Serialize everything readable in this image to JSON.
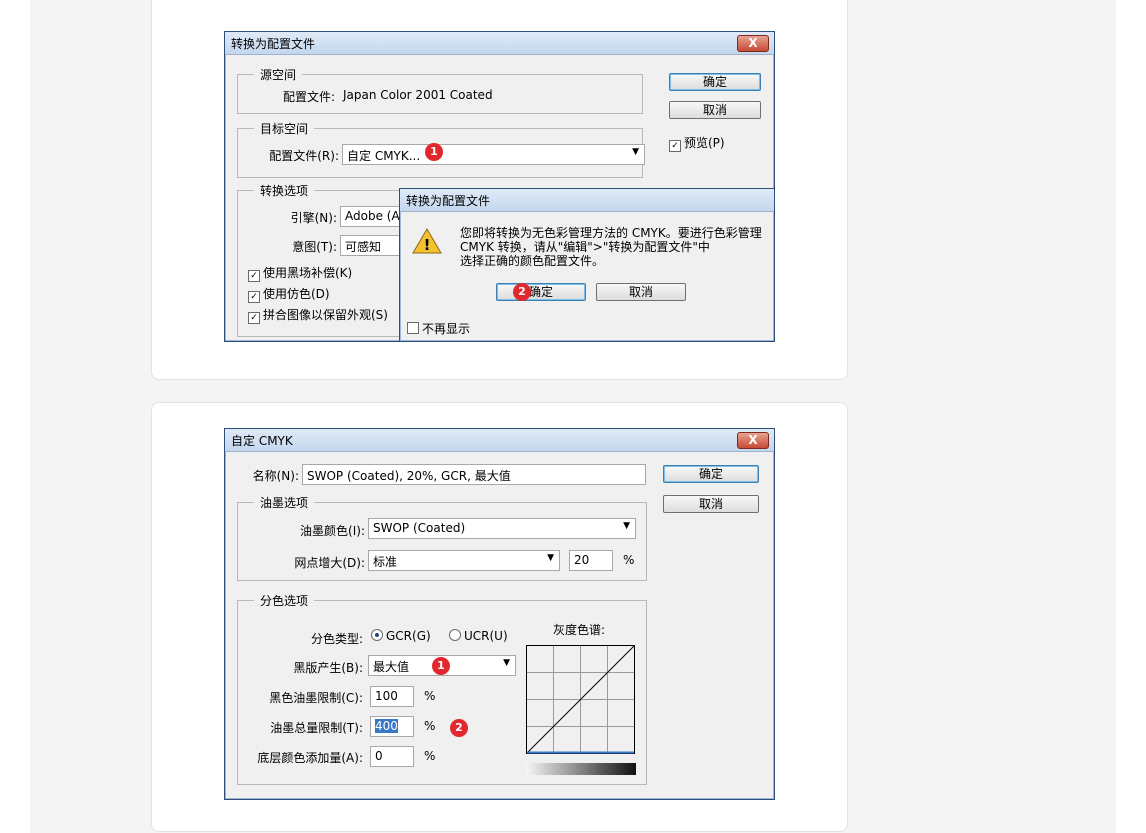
{
  "convert_dialog": {
    "title": "转换为配置文件",
    "close_glyph": "X",
    "source_group": "源空间",
    "source_profile_label": "配置文件:",
    "source_profile_value": "Japan Color 2001 Coated",
    "target_group": "目标空间",
    "target_profile_label": "配置文件(R):",
    "target_profile_value": "自定 CMYK...",
    "options_group": "转换选项",
    "engine_label": "引擎(N):",
    "engine_value": "Adobe (A",
    "intent_label": "意图(T):",
    "intent_value": "可感知",
    "check_black_point": "使用黑场补偿(K)",
    "check_dither": "使用仿色(D)",
    "check_flatten": "拼合图像以保留外观(S)",
    "ok_label": "确定",
    "cancel_label": "取消",
    "preview_label": "预览(P)",
    "badge1": "1"
  },
  "alert_dialog": {
    "title": "转换为配置文件",
    "message_line1": "您即将转换为无色彩管理方法的 CMYK。要进行色彩管理",
    "message_line2": "CMYK 转换，请从\"编辑\">\"转换为配置文件\"中",
    "message_line3": "选择正确的颜色配置文件。",
    "ok_label": "确定",
    "cancel_label": "取消",
    "dont_show_label": "不再显示",
    "badge2": "2",
    "warning_glyph": "!"
  },
  "cmyk_dialog": {
    "title": "自定 CMYK",
    "close_glyph": "X",
    "name_label": "名称(N):",
    "name_value": "SWOP (Coated), 20%, GCR, 最大值",
    "ok_label": "确定",
    "cancel_label": "取消",
    "ink_group": "油墨选项",
    "ink_colors_label": "油墨颜色(I):",
    "ink_colors_value": "SWOP (Coated)",
    "dot_gain_label": "网点增大(D):",
    "dot_gain_value": "标准",
    "dot_gain_number": "20",
    "percent": "%",
    "sep_group": "分色选项",
    "sep_type_label": "分色类型:",
    "gcr_label": "GCR(G)",
    "ucr_label": "UCR(U)",
    "gray_ramp_label": "灰度色谱:",
    "black_gen_label": "黑版产生(B):",
    "black_gen_value": "最大值",
    "black_limit_label": "黑色油墨限制(C):",
    "black_limit_value": "100",
    "total_limit_label": "油墨总量限制(T):",
    "total_limit_value": "400",
    "ucr_amount_label": "底层颜色添加量(A):",
    "ucr_amount_value": "0",
    "badge1": "1",
    "badge2": "2"
  },
  "colors": {
    "badge": "#e0282e",
    "title_bar": "#c4d7ee",
    "selection": "#3a78c8"
  }
}
